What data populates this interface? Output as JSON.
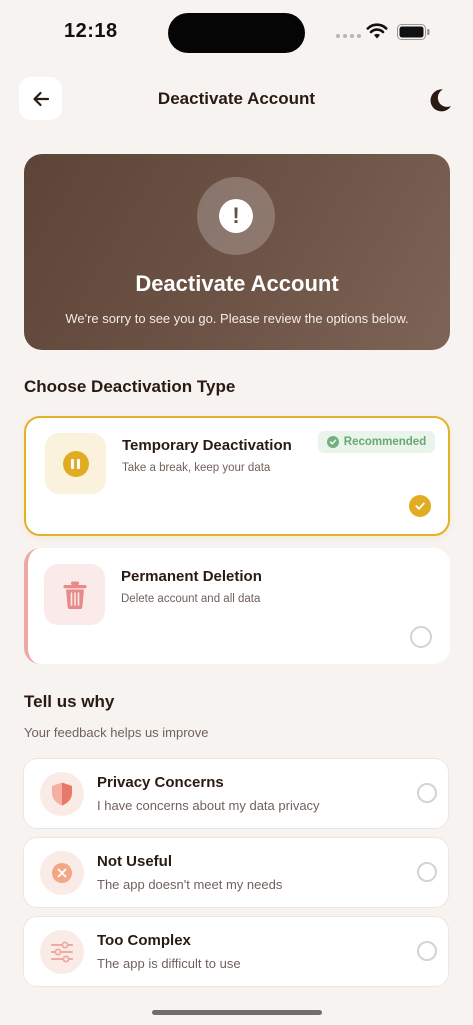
{
  "status_bar": {
    "time": "12:18"
  },
  "header": {
    "title": "Deactivate Account",
    "back_icon": "arrow-left-icon",
    "theme_icon": "moon-icon"
  },
  "hero": {
    "icon": "exclamation-icon",
    "symbol": "!",
    "title": "Deactivate Account",
    "subtitle": "We're sorry to see you go. Please review the options below."
  },
  "deactivation": {
    "section_title": "Choose Deactivation Type",
    "options": [
      {
        "title": "Temporary Deactivation",
        "subtitle": "Take a break, keep your data",
        "badge": "Recommended",
        "selected": true,
        "icon": "pause-icon"
      },
      {
        "title": "Permanent Deletion",
        "subtitle": "Delete account and all data",
        "selected": false,
        "icon": "trash-icon"
      }
    ]
  },
  "reasons": {
    "title": "Tell us why",
    "subtitle": "Your feedback helps us improve",
    "items": [
      {
        "title": "Privacy Concerns",
        "subtitle": "I have concerns about my data privacy",
        "icon": "shield-icon"
      },
      {
        "title": "Not Useful",
        "subtitle": "The app doesn't meet my needs",
        "icon": "x-circle-icon"
      },
      {
        "title": "Too Complex",
        "subtitle": "The app is difficult to use",
        "icon": "sliders-icon"
      }
    ]
  },
  "colors": {
    "accent": "#e2ac22",
    "hero_bg": "#6a5044",
    "success": "#6aa774",
    "danger_soft": "#eea9a7"
  }
}
